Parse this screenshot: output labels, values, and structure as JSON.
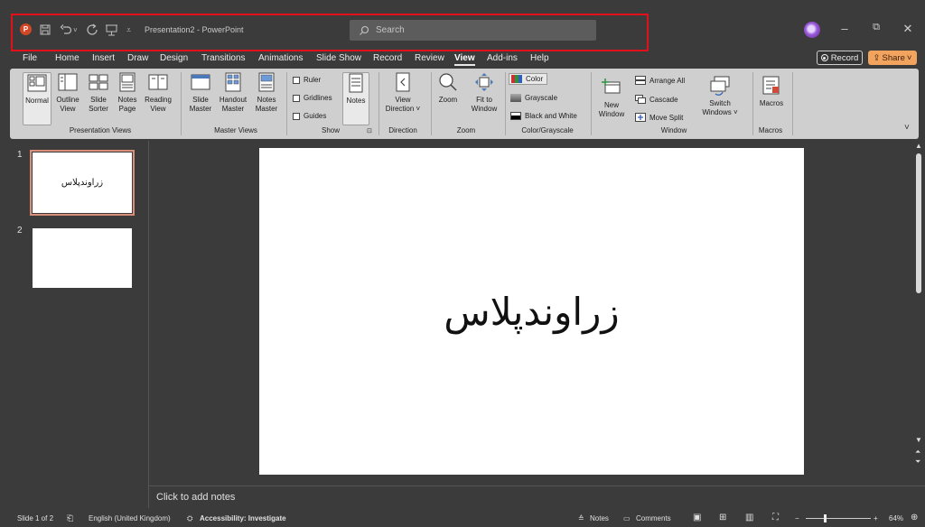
{
  "titlebar": {
    "doc_title": "Presentation2 - PowerPoint",
    "search_placeholder": "Search",
    "app_icon_letter": "P"
  },
  "menu": {
    "tabs": [
      "File",
      "Home",
      "Insert",
      "Draw",
      "Design",
      "Transitions",
      "Animations",
      "Slide Show",
      "Record",
      "Review",
      "View",
      "Add-ins",
      "Help"
    ],
    "active_tab": "View",
    "record_label": "Record",
    "share_label": "Share"
  },
  "ribbon": {
    "presentation_views": {
      "label": "Presentation Views",
      "normal": "Normal",
      "outline_l1": "Outline",
      "outline_l2": "View",
      "sorter_l1": "Slide",
      "sorter_l2": "Sorter",
      "notes_page_l1": "Notes",
      "notes_page_l2": "Page",
      "reading_l1": "Reading",
      "reading_l2": "View"
    },
    "master_views": {
      "label": "Master Views",
      "slide_l1": "Slide",
      "slide_l2": "Master",
      "handout_l1": "Handout",
      "handout_l2": "Master",
      "notes_l1": "Notes",
      "notes_l2": "Master"
    },
    "show": {
      "label": "Show",
      "ruler": "Ruler",
      "gridlines": "Gridlines",
      "guides": "Guides",
      "notes": "Notes"
    },
    "direction": {
      "label": "Direction",
      "view_l1": "View",
      "view_l2": "Direction ˅"
    },
    "zoom": {
      "label": "Zoom",
      "zoom": "Zoom",
      "fit_l1": "Fit to",
      "fit_l2": "Window"
    },
    "color": {
      "label": "Color/Grayscale",
      "color": "Color",
      "grayscale": "Grayscale",
      "bw": "Black and White"
    },
    "window": {
      "label": "Window",
      "new_l1": "New",
      "new_l2": "Window",
      "arrange_all": "Arrange All",
      "cascade": "Cascade",
      "move_split": "Move Split",
      "switch_l1": "Switch",
      "switch_l2": "Windows ˅"
    },
    "macros": {
      "label": "Macros",
      "macros": "Macros"
    }
  },
  "slides": [
    {
      "number": "1",
      "text": "زراوندپلاس"
    },
    {
      "number": "2",
      "text": ""
    }
  ],
  "slide_main_text": "زراوندپلاس",
  "notes_placeholder": "Click to add notes",
  "status": {
    "slide_count": "Slide 1 of 2",
    "language": "English (United Kingdom)",
    "accessibility": "Accessibility: Investigate",
    "notes": "Notes",
    "comments": "Comments",
    "zoom_pct": "64%"
  },
  "colors": {
    "accent_record": "#e0111b",
    "share": "#f2a35e",
    "app_logo": "#d24726"
  }
}
